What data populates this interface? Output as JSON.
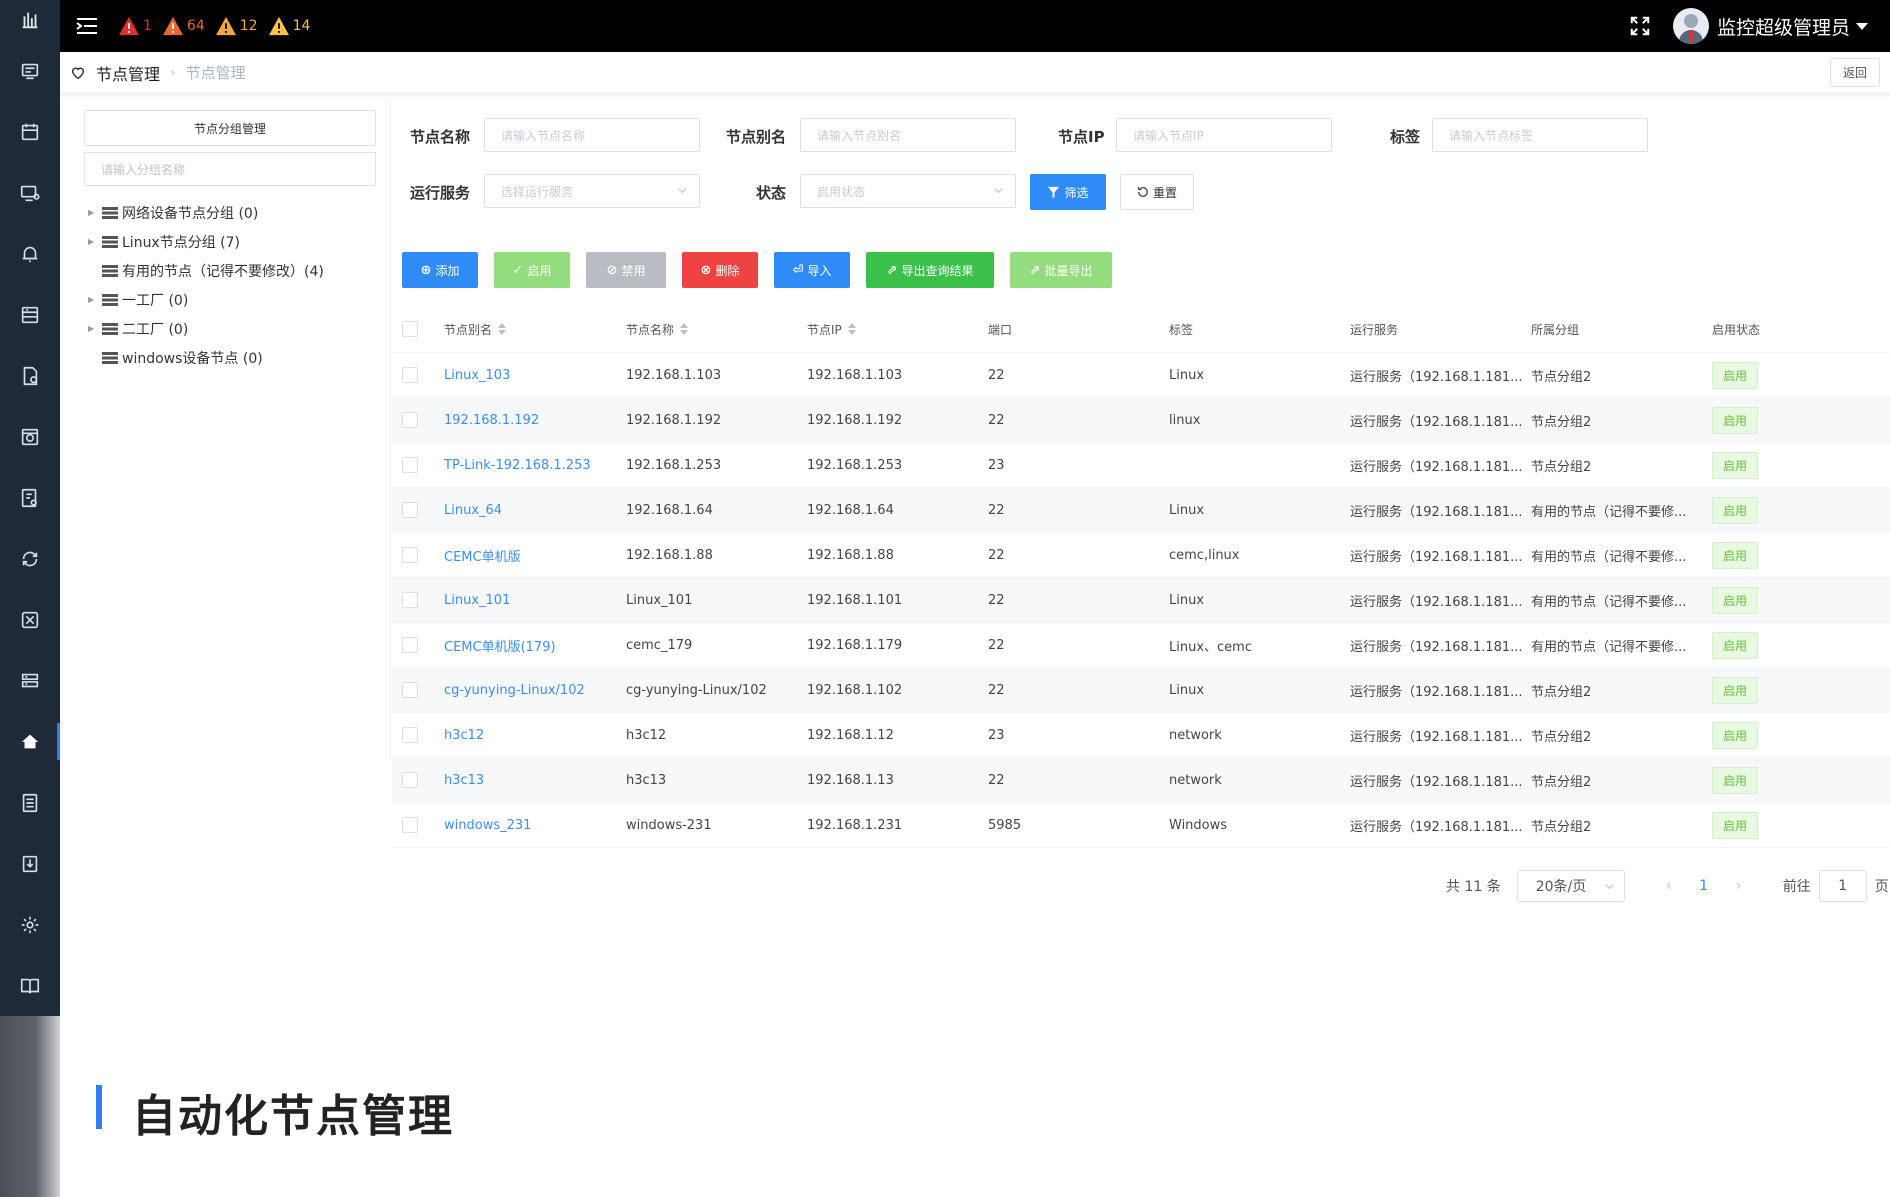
{
  "topbar": {
    "alerts": [
      {
        "count": "1",
        "color": "#e02f2f"
      },
      {
        "count": "64",
        "color": "#e86a2c"
      },
      {
        "count": "12",
        "color": "#f2a93b"
      },
      {
        "count": "14",
        "color": "#f6c544"
      }
    ],
    "user_name": "监控超级管理员"
  },
  "breadcrumb": {
    "main": "节点管理",
    "sub": "节点管理",
    "back_label": "返回"
  },
  "group_panel": {
    "title": "节点分组管理",
    "search_placeholder": "请输入分组名称",
    "nodes": [
      {
        "label": "网络设备节点分组 (0)",
        "expandable": true
      },
      {
        "label": "Linux节点分组 (7)",
        "expandable": true
      },
      {
        "label": "有用的节点（记得不要修改）(4)",
        "expandable": false
      },
      {
        "label": "一工厂 (0)",
        "expandable": true
      },
      {
        "label": "二工厂 (0)",
        "expandable": true
      },
      {
        "label": "windows设备节点 (0)",
        "expandable": false
      }
    ]
  },
  "filters": {
    "node_name_label": "节点名称",
    "node_name_placeholder": "请输入节点名称",
    "alias_label": "节点别名",
    "alias_placeholder": "请输入节点别名",
    "ip_label": "节点IP",
    "ip_placeholder": "请输入节点IP",
    "tag_label": "标签",
    "tag_placeholder": "请输入节点标签",
    "service_label": "运行服务",
    "service_placeholder": "选择运行服务",
    "status_label": "状态",
    "status_placeholder": "启用状态",
    "filter_button": "筛选",
    "reset_button": "重置"
  },
  "toolbar": {
    "add": "添加",
    "enable": "启用",
    "disable": "禁用",
    "delete": "删除",
    "import": "导入",
    "export_query": "导出查询结果",
    "batch_export": "批量导出",
    "colors": {
      "add": "#2f8cf6",
      "enable": "#94dd7e",
      "disable": "#b9bcc2",
      "delete": "#ef4343",
      "import": "#2f8cf6",
      "export_query": "#3bc14a",
      "batch_export": "#94dd7e"
    }
  },
  "table": {
    "headers": {
      "alias": "节点别名",
      "name": "节点名称",
      "ip": "节点IP",
      "port": "端口",
      "tag": "标签",
      "service": "运行服务",
      "group": "所属分组",
      "status": "启用状态"
    },
    "rows": [
      {
        "alias": "Linux_103",
        "name": "192.168.1.103",
        "ip": "192.168.1.103",
        "port": "22",
        "tag": "Linux",
        "service": "运行服务（192.168.1.181...",
        "group": "节点分组2",
        "status": "启用"
      },
      {
        "alias": "192.168.1.192",
        "name": "192.168.1.192",
        "ip": "192.168.1.192",
        "port": "22",
        "tag": "linux",
        "service": "运行服务（192.168.1.181...",
        "group": "节点分组2",
        "status": "启用"
      },
      {
        "alias": "TP-Link-192.168.1.253",
        "name": "192.168.1.253",
        "ip": "192.168.1.253",
        "port": "23",
        "tag": "",
        "service": "运行服务（192.168.1.181...",
        "group": "节点分组2",
        "status": "启用"
      },
      {
        "alias": "Linux_64",
        "name": "192.168.1.64",
        "ip": "192.168.1.64",
        "port": "22",
        "tag": "Linux",
        "service": "运行服务（192.168.1.181...",
        "group": "有用的节点（记得不要修...",
        "status": "启用"
      },
      {
        "alias": "CEMC单机版",
        "name": "192.168.1.88",
        "ip": "192.168.1.88",
        "port": "22",
        "tag": "cemc,linux",
        "service": "运行服务（192.168.1.181...",
        "group": "有用的节点（记得不要修...",
        "status": "启用"
      },
      {
        "alias": "Linux_101",
        "name": "Linux_101",
        "ip": "192.168.1.101",
        "port": "22",
        "tag": "Linux",
        "service": "运行服务（192.168.1.181...",
        "group": "有用的节点（记得不要修...",
        "status": "启用"
      },
      {
        "alias": "CEMC单机版(179)",
        "name": "cemc_179",
        "ip": "192.168.1.179",
        "port": "22",
        "tag": "Linux、cemc",
        "service": "运行服务（192.168.1.181...",
        "group": "有用的节点（记得不要修...",
        "status": "启用"
      },
      {
        "alias": "cg-yunying-Linux/102",
        "name": "cg-yunying-Linux/102",
        "ip": "192.168.1.102",
        "port": "22",
        "tag": "Linux",
        "service": "运行服务（192.168.1.181...",
        "group": "节点分组2",
        "status": "启用"
      },
      {
        "alias": "h3c12",
        "name": "h3c12",
        "ip": "192.168.1.12",
        "port": "23",
        "tag": "network",
        "service": "运行服务（192.168.1.181...",
        "group": "节点分组2",
        "status": "启用"
      },
      {
        "alias": "h3c13",
        "name": "h3c13",
        "ip": "192.168.1.13",
        "port": "22",
        "tag": "network",
        "service": "运行服务（192.168.1.181...",
        "group": "节点分组2",
        "status": "启用"
      },
      {
        "alias": "windows_231",
        "name": "windows-231",
        "ip": "192.168.1.231",
        "port": "5985",
        "tag": "Windows",
        "service": "运行服务（192.168.1.181...",
        "group": "节点分组2",
        "status": "启用"
      }
    ]
  },
  "pagination": {
    "total": "共 11 条",
    "page_size": "20条/页",
    "current_page": "1",
    "goto_label": "前往",
    "goto_value": "1",
    "page_suffix": "页"
  },
  "caption": "自动化节点管理"
}
